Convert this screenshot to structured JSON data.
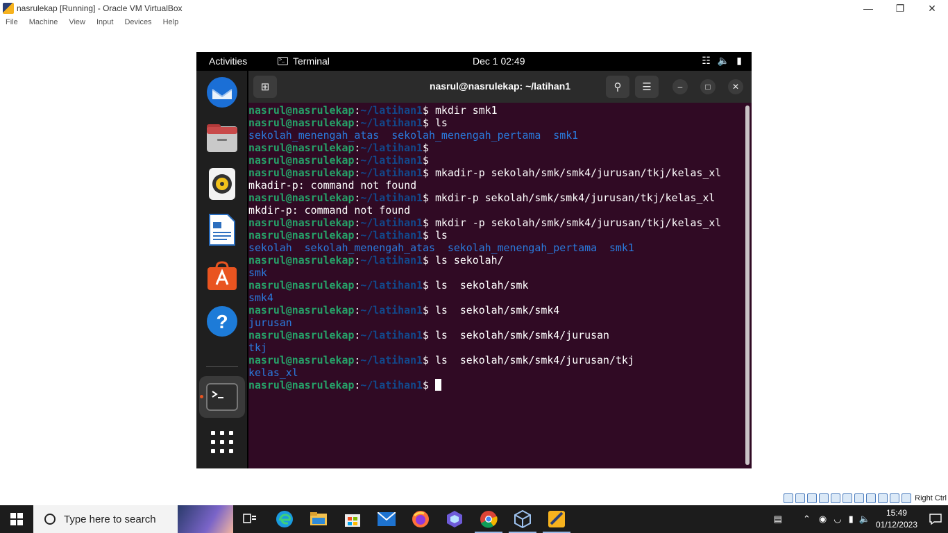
{
  "host": {
    "window_title": "nasrulekap [Running] - Oracle VM VirtualBox",
    "menu": [
      "File",
      "Machine",
      "View",
      "Input",
      "Devices",
      "Help"
    ],
    "status_hostkey": "Right Ctrl"
  },
  "guest": {
    "topbar": {
      "activities": "Activities",
      "app_name": "Terminal",
      "clock": "Dec 1  02:49"
    },
    "dock": [
      "thunderbird-icon",
      "files-icon",
      "rhythmbox-icon",
      "libreoffice-writer-icon",
      "app-center-icon",
      "help-icon",
      "terminal-icon",
      "show-apps-icon"
    ],
    "terminal": {
      "title": "nasrul@nasrulekap: ~/latihan1",
      "prompt_user": "nasrul@nasrulekap",
      "prompt_path": "~/latihan1",
      "lines": [
        {
          "type": "cmd",
          "text": " mkdir smk1"
        },
        {
          "type": "cmd",
          "text": " ls"
        },
        {
          "type": "out-dir",
          "text": "sekolah_menengah_atas  sekolah_menengah_pertama  smk1"
        },
        {
          "type": "cmd",
          "text": ""
        },
        {
          "type": "cmd",
          "text": ""
        },
        {
          "type": "cmd",
          "text": " mkadir-p sekolah/smk/smk4/jurusan/tkj/kelas_xl"
        },
        {
          "type": "out",
          "text": "mkadir-p: command not found"
        },
        {
          "type": "cmd",
          "text": " mkdir-p sekolah/smk/smk4/jurusan/tkj/kelas_xl"
        },
        {
          "type": "out",
          "text": "mkdir-p: command not found"
        },
        {
          "type": "cmd",
          "text": " mkdir -p sekolah/smk/smk4/jurusan/tkj/kelas_xl"
        },
        {
          "type": "cmd",
          "text": " ls"
        },
        {
          "type": "out-dir",
          "text": "sekolah  sekolah_menengah_atas  sekolah_menengah_pertama  smk1"
        },
        {
          "type": "cmd",
          "text": " ls sekolah/"
        },
        {
          "type": "out-dir",
          "text": "smk"
        },
        {
          "type": "cmd",
          "text": " ls  sekolah/smk"
        },
        {
          "type": "out-dir",
          "text": "smk4"
        },
        {
          "type": "cmd",
          "text": " ls  sekolah/smk/smk4"
        },
        {
          "type": "out-dir",
          "text": "jurusan"
        },
        {
          "type": "cmd",
          "text": " ls  sekolah/smk/smk4/jurusan"
        },
        {
          "type": "out-dir",
          "text": "tkj"
        },
        {
          "type": "cmd",
          "text": " ls  sekolah/smk/smk4/jurusan/tkj"
        },
        {
          "type": "out-dir",
          "text": "kelas_xl"
        },
        {
          "type": "cursor",
          "text": " "
        }
      ]
    }
  },
  "taskbar": {
    "search_placeholder": "Type here to search",
    "time": "15:49",
    "date": "01/12/2023"
  },
  "colors": {
    "terminal_bg": "#300a24",
    "prompt_user": "#26a269",
    "prompt_path": "#12488b",
    "dir": "#2a7bde"
  }
}
